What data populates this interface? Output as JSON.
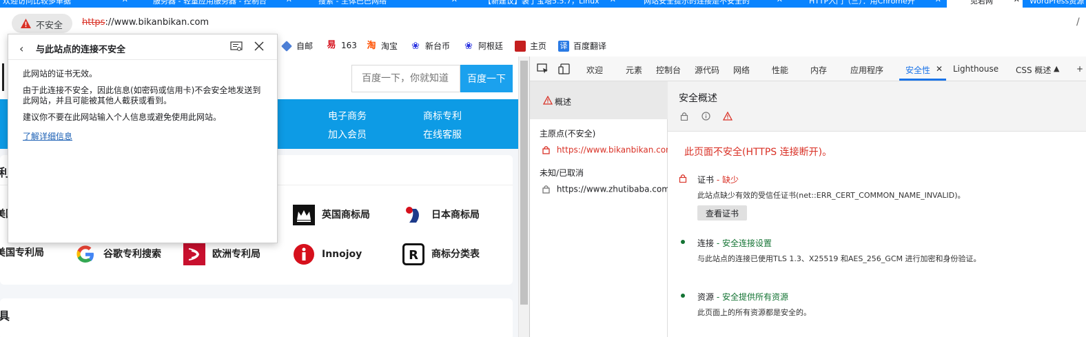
{
  "tabs": [
    {
      "label": "欢迎访问比较多单据",
      "active": false
    },
    {
      "label": "服务器 - 轻量应用服务器 - 控制台",
      "active": false
    },
    {
      "label": "搜索 - 主体巴巴网络",
      "active": false
    },
    {
      "label": "【新建议】装了宝塔5.5.7，Linux",
      "active": false
    },
    {
      "label": "网站安全提示的连接是不安全的",
      "active": false
    },
    {
      "label": "HTTP入门（三）：用Chrome开",
      "active": false
    },
    {
      "label": "见若网",
      "active": true
    },
    {
      "label": "WordPress资源",
      "active": false
    }
  ],
  "address": {
    "security_label": "不安全",
    "url_scheme": "https",
    "url_rest": "://www.bikanbikan.com"
  },
  "bookmarks": [
    {
      "label": "自邮",
      "icon": "bookmark-favicon-icon",
      "color": "#4d7fd6"
    },
    {
      "label": "163",
      "icon": "netease-icon",
      "color": "#d6101c"
    },
    {
      "label": "淘宝",
      "icon": "taobao-icon",
      "color": "#ff5000"
    },
    {
      "label": "新台币",
      "icon": "baidu-paw-icon",
      "color": "#2932e1"
    },
    {
      "label": "阿根廷",
      "icon": "baidu-paw-icon",
      "color": "#2932e1"
    },
    {
      "label": "主页",
      "icon": "home-bookmark-icon",
      "color": "#c41f1f"
    },
    {
      "label": "百度翻译",
      "icon": "baidu-translate-icon",
      "color": "#2a7ae4"
    }
  ],
  "page": {
    "search_placeholder": "百度一下，你就知道",
    "search_button": "百度一下",
    "nav": [
      "电子商务",
      "商标专利",
      "加入会员",
      "在线客服"
    ],
    "card1_title": "利",
    "logos_row1": [
      "美国",
      "英国商标局",
      "日本商标局"
    ],
    "logos_row2": [
      "美国专利局",
      "谷歌专利搜索",
      "欧洲专利局",
      "Innojoy",
      "商标分类表"
    ],
    "card2_title": "具"
  },
  "popup": {
    "title": "与此站点的连接不安全",
    "p1": "此网站的证书无效。",
    "p2": "由于此连接不安全，因此信息(如密码或信用卡)不会安全地发送到此网站，并且可能被其他人截获或看到。",
    "p3": "建议你不要在此网站输入个人信息或避免使用此网站。",
    "link": "了解详细信息"
  },
  "devtools": {
    "tabs": [
      "欢迎",
      "元素",
      "控制台",
      "源代码",
      "网络",
      "性能",
      "内存",
      "应用程序",
      "安全性",
      "Lighthouse",
      "CSS 概述"
    ],
    "active_tab": "安全性",
    "sidebar": {
      "overview": "概述",
      "main_origin_header": "主原点(不安全)",
      "main_origin": "https://www.bikanbikan.com",
      "unknown_header": "未知/已取消",
      "unknown_origin": "https://www.zhutibaba.com"
    },
    "main": {
      "title": "安全概述",
      "summary": "此页面不安全(HTTPS 连接断开)。",
      "cert_label": "证书",
      "cert_status": " - 缺少",
      "cert_desc": "此站点缺少有效的受信任证书(net::ERR_CERT_COMMON_NAME_INVALID)。",
      "view_cert": "查看证书",
      "conn_label": "连接",
      "conn_status": " - 安全连接设置",
      "conn_desc": "与此站点的连接已使用TLS 1.3、X25519 和AES_256_GCM 进行加密和身份验证。",
      "res_label": "资源",
      "res_status": " - 安全提供所有资源",
      "res_desc": "此页面上的所有资源都是安全的。"
    }
  },
  "colors": {
    "danger": "#d93025",
    "secure": "#137333",
    "accent": "#1a73e8",
    "page_blue": "#0d9be5"
  }
}
